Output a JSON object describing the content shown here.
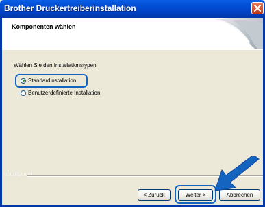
{
  "window": {
    "title": "Brother Druckertreiberinstallation"
  },
  "header": {
    "heading": "Komponenten wählen"
  },
  "body": {
    "instruction": "Wählen Sie den Installationstypen.",
    "options": [
      {
        "label": "Standardinstallation",
        "selected": true
      },
      {
        "label": "Benutzerdefinierte Installation",
        "selected": false
      }
    ]
  },
  "footer": {
    "brand": "InstallShield",
    "back_label": "< Zurück",
    "next_label": "Weiter >",
    "cancel_label": "Abbrechen"
  },
  "colors": {
    "titlebar": "#0351d9",
    "highlight": "#1565c0",
    "dialog_bg": "#ece9d8"
  },
  "icons": [
    "close-icon",
    "header-wave-art",
    "pointer-arrow-icon"
  ]
}
